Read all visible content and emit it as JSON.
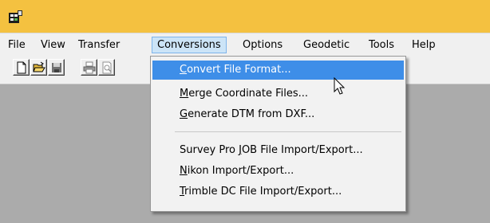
{
  "app": {
    "icon": "spreadsheet-app-icon"
  },
  "menubar": {
    "items": [
      "File",
      "View",
      "Transfer",
      "Conversions",
      "Options",
      "Geodetic",
      "Tools",
      "Help"
    ],
    "active": "Conversions"
  },
  "toolbar": {
    "buttons": [
      "new-document-icon",
      "open-folder-icon",
      "save-disk-icon",
      "print-icon",
      "print-preview-icon"
    ]
  },
  "conversions_menu": {
    "items": [
      {
        "pre": "",
        "mnemonic": "C",
        "post": "onvert File Format...",
        "highlighted": true
      },
      {
        "pre": "",
        "mnemonic": "M",
        "post": "erge Coordinate Files...",
        "highlighted": false
      },
      {
        "pre": "",
        "mnemonic": "G",
        "post": "enerate DTM from DXF...",
        "highlighted": false
      },
      {
        "pre": "Survey Pro ",
        "mnemonic": "J",
        "post": "OB File Import/Export...",
        "highlighted": false
      },
      {
        "pre": "",
        "mnemonic": "N",
        "post": "ikon Import/Export...",
        "highlighted": false
      },
      {
        "pre": "",
        "mnemonic": "T",
        "post": "rimble DC File Import/Export...",
        "highlighted": false
      }
    ]
  },
  "colors": {
    "titlebar": "#f4c140",
    "menu_highlight": "#3e8ee8",
    "workspace": "#ababab"
  }
}
